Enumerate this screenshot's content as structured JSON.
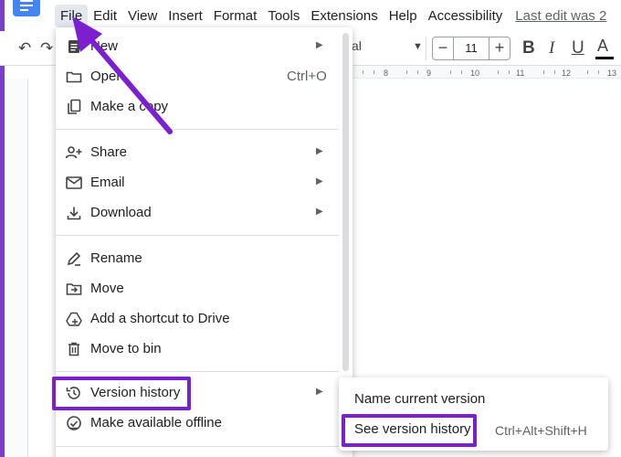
{
  "menubar": {
    "items": [
      "File",
      "Edit",
      "View",
      "Insert",
      "Format",
      "Tools",
      "Extensions",
      "Help",
      "Accessibility"
    ],
    "last_edit": "Last edit was 2"
  },
  "toolbar": {
    "font_name": "al",
    "font_size": "11",
    "minus": "−",
    "plus": "+",
    "bold": "B",
    "italic": "I",
    "underline": "U",
    "text_color": "A"
  },
  "ruler": {
    "ticks": [
      "8",
      "9",
      "10",
      "11",
      "12",
      "13"
    ]
  },
  "file_menu": {
    "items": [
      {
        "label": "New",
        "icon": "document-icon",
        "arrow": true,
        "shortcut": ""
      },
      {
        "label": "Open",
        "icon": "folder-icon",
        "arrow": false,
        "shortcut": "Ctrl+O"
      },
      {
        "label": "Make a copy",
        "icon": "copy-icon",
        "arrow": false,
        "shortcut": ""
      },
      {
        "label": "Share",
        "icon": "person-add-icon",
        "arrow": true,
        "shortcut": ""
      },
      {
        "label": "Email",
        "icon": "email-icon",
        "arrow": true,
        "shortcut": ""
      },
      {
        "label": "Download",
        "icon": "download-icon",
        "arrow": true,
        "shortcut": ""
      },
      {
        "label": "Rename",
        "icon": "rename-icon",
        "arrow": false,
        "shortcut": ""
      },
      {
        "label": "Move",
        "icon": "move-folder-icon",
        "arrow": false,
        "shortcut": ""
      },
      {
        "label": "Add a shortcut to Drive",
        "icon": "drive-shortcut-icon",
        "arrow": false,
        "shortcut": ""
      },
      {
        "label": "Move to bin",
        "icon": "trash-icon",
        "arrow": false,
        "shortcut": ""
      },
      {
        "label": "Version history",
        "icon": "history-icon",
        "arrow": true,
        "shortcut": ""
      },
      {
        "label": "Make available offline",
        "icon": "offline-check-icon",
        "arrow": false,
        "shortcut": ""
      }
    ]
  },
  "version_submenu": {
    "items": [
      {
        "label": "Name current version",
        "shortcut": ""
      },
      {
        "label": "See version history",
        "shortcut": "Ctrl+Alt+Shift+H"
      }
    ]
  },
  "colors": {
    "annotation": "#7b1fd1",
    "brand": "#4285f4"
  }
}
